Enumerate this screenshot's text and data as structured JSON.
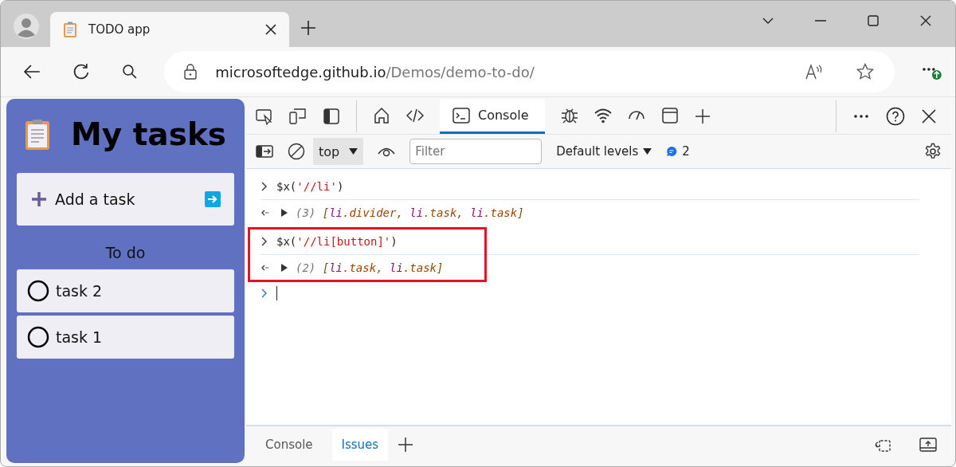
{
  "browser": {
    "tab_title": "TODO app",
    "url_host": "microsoftedge.github.io",
    "url_path": "/Demos/demo-to-do/"
  },
  "app": {
    "title": "My tasks",
    "add_task": "Add a task",
    "section": "To do",
    "tasks": [
      {
        "label": "task 2",
        "done": false
      },
      {
        "label": "task 1",
        "done": false
      }
    ]
  },
  "devtools": {
    "tools": [
      {
        "kind": "home",
        "selected": false
      },
      {
        "kind": "elements",
        "selected": false
      },
      {
        "kind": "console",
        "label": "Console",
        "selected": true
      },
      {
        "kind": "sources",
        "selected": false
      },
      {
        "kind": "network",
        "selected": false
      },
      {
        "kind": "performance",
        "selected": false
      },
      {
        "kind": "application",
        "selected": false
      }
    ],
    "context": "top",
    "filter_placeholder": "Filter",
    "levels": "Default levels",
    "message_count": "2",
    "groups": [
      {
        "highlighted": false,
        "entries": [
          {
            "kind": "input",
            "tokens": [
              {
                "text": "$x(",
                "kind": "plain"
              },
              {
                "text": "'//li'",
                "kind": "string"
              },
              {
                "text": ")",
                "kind": "plain"
              }
            ]
          },
          {
            "kind": "output",
            "tokens": [
              {
                "text": "(3) ",
                "kind": "count"
              },
              {
                "text": "[",
                "kind": "punct"
              },
              {
                "text": "li",
                "kind": "tag"
              },
              {
                "text": ".divider",
                "kind": "cls"
              },
              {
                "text": ", ",
                "kind": "punct"
              },
              {
                "text": "li",
                "kind": "tag"
              },
              {
                "text": ".task",
                "kind": "cls"
              },
              {
                "text": ", ",
                "kind": "punct"
              },
              {
                "text": "li",
                "kind": "tag"
              },
              {
                "text": ".task",
                "kind": "cls"
              },
              {
                "text": "]",
                "kind": "punct"
              }
            ]
          }
        ]
      },
      {
        "highlighted": true,
        "entries": [
          {
            "kind": "input",
            "tokens": [
              {
                "text": "$x(",
                "kind": "plain"
              },
              {
                "text": "'//li[button]'",
                "kind": "string"
              },
              {
                "text": ")",
                "kind": "plain"
              }
            ]
          },
          {
            "kind": "output",
            "tokens": [
              {
                "text": "(2) ",
                "kind": "count"
              },
              {
                "text": "[",
                "kind": "punct"
              },
              {
                "text": "li",
                "kind": "tag"
              },
              {
                "text": ".task",
                "kind": "cls"
              },
              {
                "text": ", ",
                "kind": "punct"
              },
              {
                "text": "li",
                "kind": "tag"
              },
              {
                "text": ".task",
                "kind": "cls"
              },
              {
                "text": "]",
                "kind": "punct"
              }
            ]
          }
        ]
      }
    ],
    "drawer_tabs": [
      {
        "label": "Console",
        "selected": false
      },
      {
        "label": "Issues",
        "selected": true
      }
    ]
  }
}
